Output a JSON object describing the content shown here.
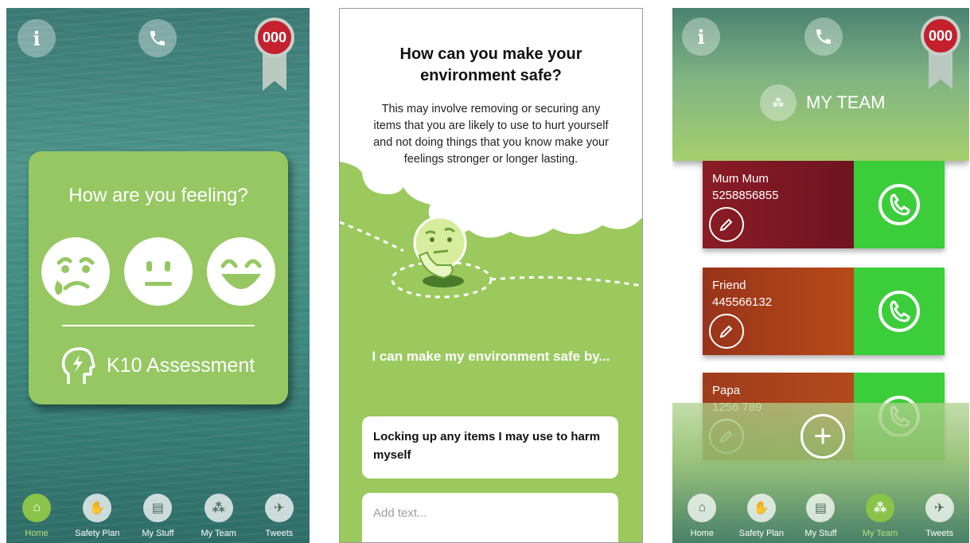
{
  "screen1": {
    "emergency_label": "000",
    "feeling_title": "How are you feeling?",
    "k10_label": "K10 Assessment",
    "nav": [
      {
        "label": "Home",
        "active": true
      },
      {
        "label": "Safety Plan",
        "active": false
      },
      {
        "label": "My Stuff",
        "active": false
      },
      {
        "label": "My Team",
        "active": false
      },
      {
        "label": "Tweets",
        "active": false
      }
    ]
  },
  "screen2": {
    "question_title": "How can you make your environment safe?",
    "question_desc": "This may involve removing or securing any items that you are likely to use to hurt yourself and not doing things that you know make your feelings stronger or longer lasting.",
    "prompt": "I can make my environment safe by...",
    "entry_text": "Locking up any items I may use to harm myself",
    "add_placeholder": "Add text..."
  },
  "screen3": {
    "emergency_label": "000",
    "title": "MY TEAM",
    "contacts": [
      {
        "name": "Mum Mum",
        "phone": "5258856855",
        "color": "#7a1620"
      },
      {
        "name": "Friend",
        "phone": "445566132",
        "color": "#a23a16"
      },
      {
        "name": "Papa",
        "phone": "1256 789",
        "color": "#a8451e"
      }
    ],
    "nav": [
      {
        "label": "Home",
        "active": false
      },
      {
        "label": "Safety Plan",
        "active": false
      },
      {
        "label": "My Stuff",
        "active": false
      },
      {
        "label": "My Team",
        "active": true
      },
      {
        "label": "Tweets",
        "active": false
      }
    ]
  },
  "colors": {
    "accent_green": "#96c762",
    "emergency_red": "#c4202e",
    "call_green": "#3ccd3a"
  }
}
